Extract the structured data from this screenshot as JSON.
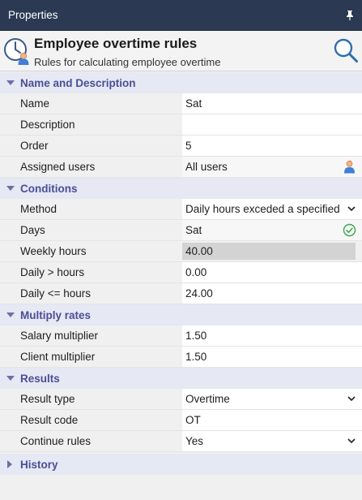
{
  "window": {
    "title": "Properties",
    "pin_icon": "pin-icon"
  },
  "header": {
    "title": "Employee overtime rules",
    "subtitle": "Rules for calculating employee overtime",
    "icon": "clock-user-icon",
    "search_icon": "search-icon"
  },
  "colors": {
    "titlebar": "#2b3a52",
    "category_bg": "#e6e8f3",
    "category_text": "#4a4f96",
    "check_green": "#3aa64a"
  },
  "sections": {
    "name_description": {
      "label": "Name and Description",
      "expanded": true,
      "name": {
        "label": "Name",
        "value": "Sat"
      },
      "description": {
        "label": "Description",
        "value": ""
      },
      "order": {
        "label": "Order",
        "value": "5"
      },
      "assigned_users": {
        "label": "Assigned users",
        "value": "All users",
        "icon": "user-icon"
      }
    },
    "conditions": {
      "label": "Conditions",
      "expanded": true,
      "method": {
        "label": "Method",
        "value": "Daily hours exceded a specified"
      },
      "days": {
        "label": "Days",
        "value": "Sat",
        "icon": "check-circle-icon"
      },
      "weekly_hours": {
        "label": "Weekly hours",
        "value": "40.00"
      },
      "daily_gt_hours": {
        "label": "Daily > hours",
        "value": "0.00"
      },
      "daily_lte_hours": {
        "label": "Daily <= hours",
        "value": "24.00"
      }
    },
    "multiply_rates": {
      "label": "Multiply rates",
      "expanded": true,
      "salary_multiplier": {
        "label": "Salary multiplier",
        "value": "1.50"
      },
      "client_multiplier": {
        "label": "Client multiplier",
        "value": "1.50"
      }
    },
    "results": {
      "label": "Results",
      "expanded": true,
      "result_type": {
        "label": "Result type",
        "value": "Overtime"
      },
      "result_code": {
        "label": "Result code",
        "value": "OT"
      },
      "continue_rules": {
        "label": "Continue rules",
        "value": "Yes"
      }
    },
    "history": {
      "label": "History",
      "expanded": false
    }
  }
}
